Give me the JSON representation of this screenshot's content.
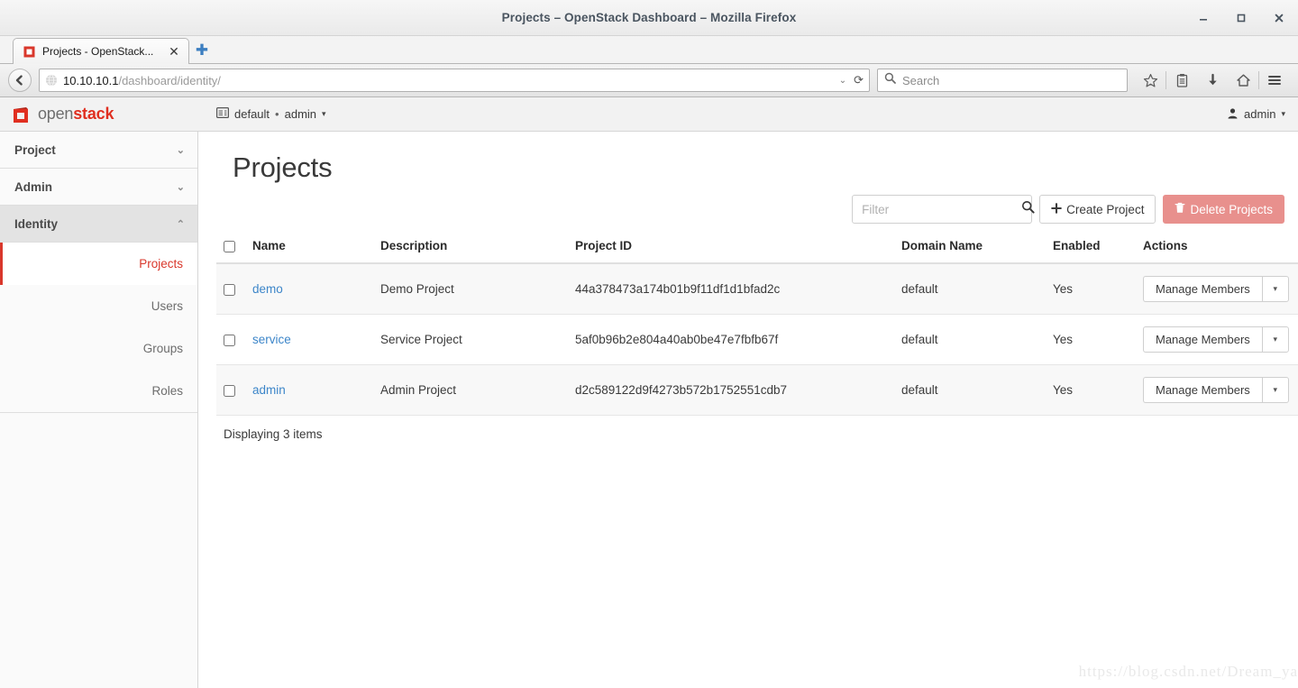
{
  "window": {
    "title": "Projects – OpenStack Dashboard – Mozilla Firefox",
    "minimize_label": "−",
    "maximize_label": "□",
    "close_label": "✕"
  },
  "browser": {
    "tab": {
      "label": "Projects - OpenStack...",
      "close_label": "✕",
      "favicon": "openstack-favicon-icon"
    },
    "new_tab_label": "✚",
    "back_label": "❮",
    "url_host": "10.10.10.1",
    "url_path": "/dashboard/identity/",
    "url_dropdown_label": "⌄",
    "reload_label": "⟳",
    "search_placeholder": "Search",
    "search_icon": "search-icon",
    "toolbar_icons": [
      "star-icon",
      "clipboard-icon",
      "download-icon",
      "home-icon",
      "hamburger-menu-icon"
    ]
  },
  "osheader": {
    "logo_open": "open",
    "logo_stack": "stack",
    "context_icon": "domain-icon",
    "context_domain": "default",
    "context_separator": "•",
    "context_project": "admin",
    "context_caret": "▾",
    "user_icon": "user-icon",
    "user_name": "admin",
    "user_caret": "▾"
  },
  "sidebar": {
    "groups": [
      {
        "label": "Project",
        "chevron": "⌄",
        "expanded": false
      },
      {
        "label": "Admin",
        "chevron": "⌄",
        "expanded": false
      },
      {
        "label": "Identity",
        "chevron": "⌃",
        "expanded": true
      }
    ],
    "identity_items": [
      {
        "label": "Projects",
        "active": true
      },
      {
        "label": "Users",
        "active": false
      },
      {
        "label": "Groups",
        "active": false
      },
      {
        "label": "Roles",
        "active": false
      }
    ]
  },
  "main": {
    "page_title": "Projects",
    "filter_placeholder": "Filter",
    "filter_value": "",
    "filter_icon": "search-icon",
    "create_button": {
      "icon": "plus-icon",
      "label": "Create Project"
    },
    "delete_button": {
      "icon": "trash-icon",
      "label": "Delete Projects"
    },
    "table": {
      "headers": [
        "",
        "Name",
        "Description",
        "Project ID",
        "Domain Name",
        "Enabled",
        "Actions"
      ],
      "rows": [
        {
          "name": "demo",
          "description": "Demo Project",
          "project_id": "44a378473a174b01b9f11df1d1bfad2c",
          "domain_name": "default",
          "enabled": "Yes",
          "action_label": "Manage Members",
          "action_caret": "▾"
        },
        {
          "name": "service",
          "description": "Service Project",
          "project_id": "5af0b96b2e804a40ab0be47e7fbfb67f",
          "domain_name": "default",
          "enabled": "Yes",
          "action_label": "Manage Members",
          "action_caret": "▾"
        },
        {
          "name": "admin",
          "description": "Admin Project",
          "project_id": "d2c589122d9f4273b572b1752551cdb7",
          "domain_name": "default",
          "enabled": "Yes",
          "action_label": "Manage Members",
          "action_caret": "▾"
        }
      ]
    },
    "footer_text": "Displaying 3 items"
  },
  "watermark": "https://blog.csdn.net/Dream_ya",
  "colors": {
    "brand_red": "#e02f20",
    "active_red": "#d9372b",
    "link_blue": "#3d86c9",
    "danger_muted": "#e8908d"
  }
}
